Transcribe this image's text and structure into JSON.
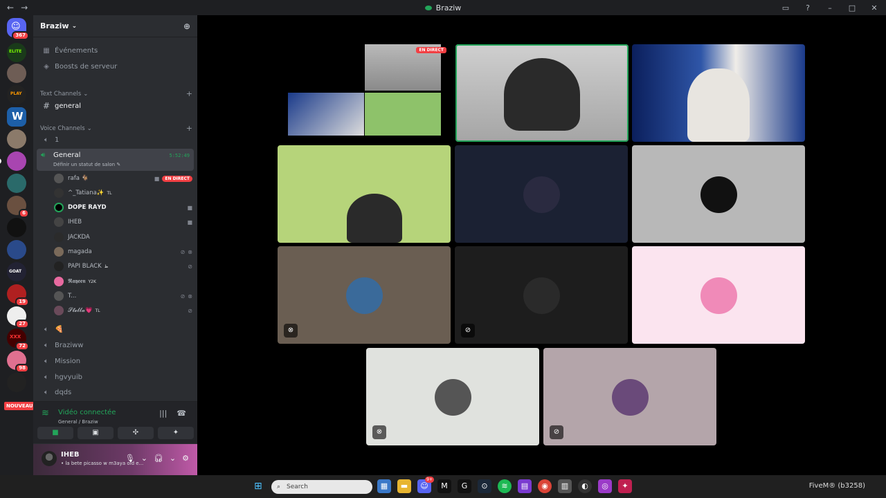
{
  "window": {
    "title": "Braziw",
    "back": "←",
    "forward": "→",
    "icons": [
      "inbox-icon",
      "help-icon",
      "minimize-icon",
      "maximize-icon",
      "close-icon"
    ]
  },
  "rail": {
    "home_badge": "367",
    "badges": {
      "s13": "6",
      "s19": "19",
      "s20": "27",
      "s21": "72",
      "s22": "98"
    },
    "new_label": "NOUVEAU",
    "logo_text": {
      "elite": "ELITE",
      "play": "PLAY",
      "w": "W",
      "goat": "GOAT",
      "xxx": "XXX"
    }
  },
  "server": {
    "name": "Braziw",
    "events": "Événements",
    "boosts": "Boosts de serveur",
    "text_category": "Text Channels",
    "text_channels": [
      "general"
    ],
    "voice_category": "Voice Channels",
    "voice_channel_1": "1",
    "active_voice": {
      "name": "General",
      "status_hint": "Définir un statut de salon",
      "timer": "5:52:49"
    },
    "members": [
      {
        "name": "rafa 🐐",
        "live": "EN DIRECT"
      },
      {
        "name": "^_Tatiana✨",
        "tag": "TL"
      },
      {
        "name": "𝗗𝗢𝗣𝗘 𝗥𝗔𝗬𝗗"
      },
      {
        "name": "IHEB"
      },
      {
        "name": "JACKDA"
      },
      {
        "name": "magada"
      },
      {
        "name": "PAPI BLACK",
        "tag": "ظ"
      },
      {
        "name": "𝕽𝖆𝖞𝖊𝖊𝖓",
        "tag": "Y2K"
      },
      {
        "name": "T..."
      },
      {
        "name": "𝓢𝓽𝓮𝓵𝓵𝓪💗",
        "tag": "TL"
      }
    ],
    "other_voice": [
      "🍕",
      "Braziww",
      "Mission",
      "hgvyuib",
      "dqds"
    ]
  },
  "rtc": {
    "status": "Vidéo connectée",
    "location": "General / Braziw"
  },
  "user": {
    "name": "IHEB",
    "status": "• la bete picasso w m3aya old e..."
  },
  "stage": {
    "live_badge": "EN DIRECT"
  },
  "taskbar": {
    "search_placeholder": "Search",
    "tray_text": "FiveM® (b3258)",
    "discord_badge": "9+"
  },
  "colors": {
    "accent_green": "#23a55a",
    "live_red": "#f23f43",
    "sidebar_bg": "#2b2d31",
    "rail_bg": "#1e1f22"
  }
}
